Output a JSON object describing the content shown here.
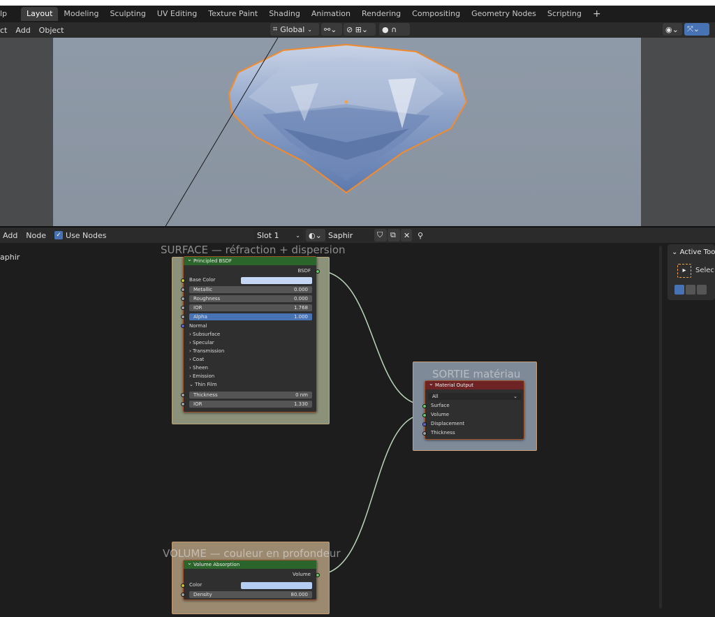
{
  "app_menu_fragment": "lp",
  "workspaces": [
    "Layout",
    "Modeling",
    "Sculpting",
    "UV Editing",
    "Texture Paint",
    "Shading",
    "Animation",
    "Rendering",
    "Compositing",
    "Geometry Nodes",
    "Scripting"
  ],
  "add_workspace": "+",
  "viewport_header": {
    "menus": [
      "ct",
      "Add",
      "Object"
    ],
    "transform_orientation": "Global"
  },
  "node_header": {
    "menus": [
      "Add",
      "Node"
    ],
    "use_nodes_label": "Use Nodes",
    "slot": "Slot 1",
    "material_name": "Saphir"
  },
  "left_label": "aphir",
  "frames": {
    "surface": "SURFACE — réfraction + dispersion",
    "output": "SORTIE matériau",
    "volume": "VOLUME — couleur en profondeur"
  },
  "principled": {
    "title": "Principled BSDF",
    "output": "BSDF",
    "base_color": "Base Color",
    "metallic": {
      "label": "Metallic",
      "value": "0.000"
    },
    "roughness": {
      "label": "Roughness",
      "value": "0.000"
    },
    "ior": {
      "label": "IOR",
      "value": "1.768"
    },
    "alpha": {
      "label": "Alpha",
      "value": "1.000"
    },
    "normal": "Normal",
    "panels": [
      "Subsurface",
      "Specular",
      "Transmission",
      "Coat",
      "Sheen",
      "Emission"
    ],
    "thin_film": "Thin Film",
    "thickness": {
      "label": "Thickness",
      "value": "0 nm"
    },
    "tf_ior": {
      "label": "IOR",
      "value": "1.330"
    }
  },
  "material_output": {
    "title": "Material Output",
    "target": "All",
    "inputs": [
      "Surface",
      "Volume",
      "Displacement",
      "Thickness"
    ]
  },
  "volume_absorption": {
    "title": "Volume Absorption",
    "output": "Volume",
    "color": "Color",
    "density": {
      "label": "Density",
      "value": "80.000"
    }
  },
  "sidebar": {
    "active_tool": "Active Too",
    "select": "Selec"
  },
  "colors": {
    "accent": "#4772b3",
    "node_header_green": "#2b652b",
    "output_header": "#6e2424",
    "selection_outline": "#f28a2e"
  }
}
